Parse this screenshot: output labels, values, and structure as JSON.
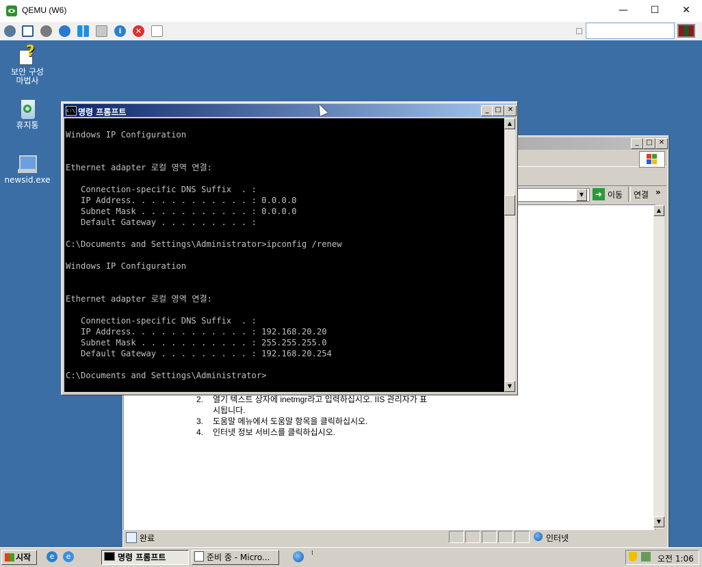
{
  "host": {
    "title": "QEMU (W6)",
    "minimize": "—",
    "maximize": "☐",
    "close": "✕",
    "toolbar_icons": [
      "network-icon",
      "fullscreen-icon",
      "settings-icon",
      "refresh-icon",
      "windows-icon",
      "drive-icon",
      "info-icon",
      "stop-icon",
      "clipboard-icon"
    ],
    "search_value": ""
  },
  "desktop": {
    "icons": [
      {
        "label_line1": "보안 구성",
        "label_line2": "마법사"
      },
      {
        "label_line1": "휴지통",
        "label_line2": ""
      },
      {
        "label_line1": "newsid.exe",
        "label_line2": ""
      }
    ]
  },
  "cmd": {
    "title": "명령 프롬프트",
    "lines": [
      "",
      "Windows IP Configuration",
      "",
      "",
      "Ethernet adapter 로컬 영역 연결:",
      "",
      "   Connection-specific DNS Suffix  . :",
      "   IP Address. . . . . . . . . . . . : 0.0.0.0",
      "   Subnet Mask . . . . . . . . . . . : 0.0.0.0",
      "   Default Gateway . . . . . . . . . :",
      "",
      "C:\\Documents and Settings\\Administrator>ipconfig /renew",
      "",
      "Windows IP Configuration",
      "",
      "",
      "Ethernet adapter 로컬 영역 연결:",
      "",
      "   Connection-specific DNS Suffix  . :",
      "   IP Address. . . . . . . . . . . . : 192.168.20.20",
      "   Subnet Mask . . . . . . . . . . . : 255.255.255.0",
      "   Default Gateway . . . . . . . . . : 192.168.20.254",
      "",
      "C:\\Documents and Settings\\Administrator>"
    ]
  },
  "ie": {
    "go_label": "이동",
    "links_label": "연결",
    "steps": [
      {
        "num": "2.",
        "text": "열기 텍스트 상자에 inetmgr라고 입력하십시오. IIS 관리자가 표",
        "text2": "시됩니다."
      },
      {
        "num": "3.",
        "text": "도움말 메뉴에서 도움말 항목을 클릭하십시오.",
        "text2": ""
      },
      {
        "num": "4.",
        "text": "인터넷 정보 서비스를 클릭하십시오.",
        "text2": ""
      }
    ],
    "status_text": "완료",
    "zone_text": "인터넷"
  },
  "taskbar": {
    "start": "시작",
    "tasks": [
      "명령 프롬프트",
      "준비 중 - Micro..."
    ],
    "clock": "오전 1:06"
  },
  "colors": {
    "desktop": "#3a6ea5",
    "title_active": "#0a246a",
    "title_inactive": "#808080",
    "console_bg": "#000000",
    "console_fg": "#c0c0c0"
  }
}
